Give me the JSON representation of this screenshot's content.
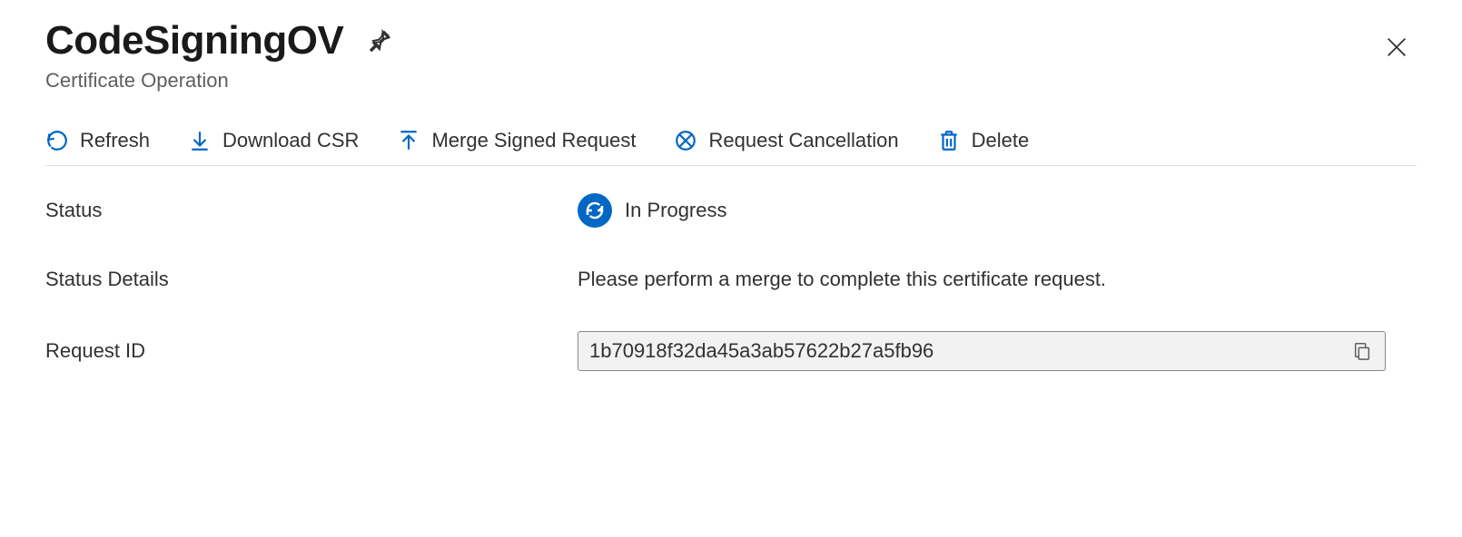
{
  "header": {
    "title": "CodeSigningOV",
    "subtitle": "Certificate Operation"
  },
  "toolbar": {
    "refresh": "Refresh",
    "download_csr": "Download CSR",
    "merge_signed": "Merge Signed Request",
    "request_cancel": "Request Cancellation",
    "delete": "Delete"
  },
  "details": {
    "status_label": "Status",
    "status_value": "In Progress",
    "status_details_label": "Status Details",
    "status_details_value": "Please perform a merge to complete this certificate request.",
    "request_id_label": "Request ID",
    "request_id_value": "1b70918f32da45a3ab57622b27a5fb96"
  },
  "colors": {
    "azure_blue": "#0067c5"
  }
}
